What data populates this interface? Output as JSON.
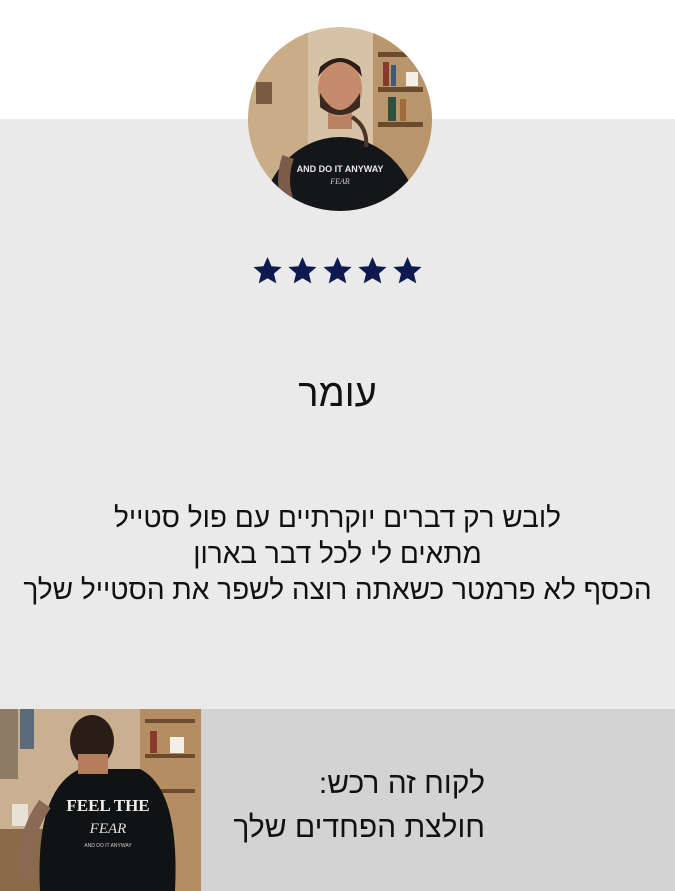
{
  "review": {
    "rating": 5,
    "rating_max": 5,
    "star_color": "#0e1a4f",
    "reviewer_name": "עומר",
    "lines": [
      "לובש רק דברים יוקרתיים עם פול סטייל",
      "מתאים לי לכל דבר בארון",
      "הכסף לא פרמטר כשאתה רוצה לשפר את הסטייל שלך"
    ]
  },
  "avatar_shirt_print": {
    "line1": "AND DO IT ANYWAY",
    "line2": "FEAR"
  },
  "product": {
    "shirt_print": {
      "line1": "FEEL THE",
      "line2": "FEAR",
      "line3": "AND DO IT ANYWAY"
    },
    "caption_line1": "לקוח זה רכש:",
    "caption_line2": "חולצת הפחדים שלך"
  },
  "colors": {
    "panel_bg": "#ebeaea",
    "caption_bg": "#d3d3d3"
  }
}
